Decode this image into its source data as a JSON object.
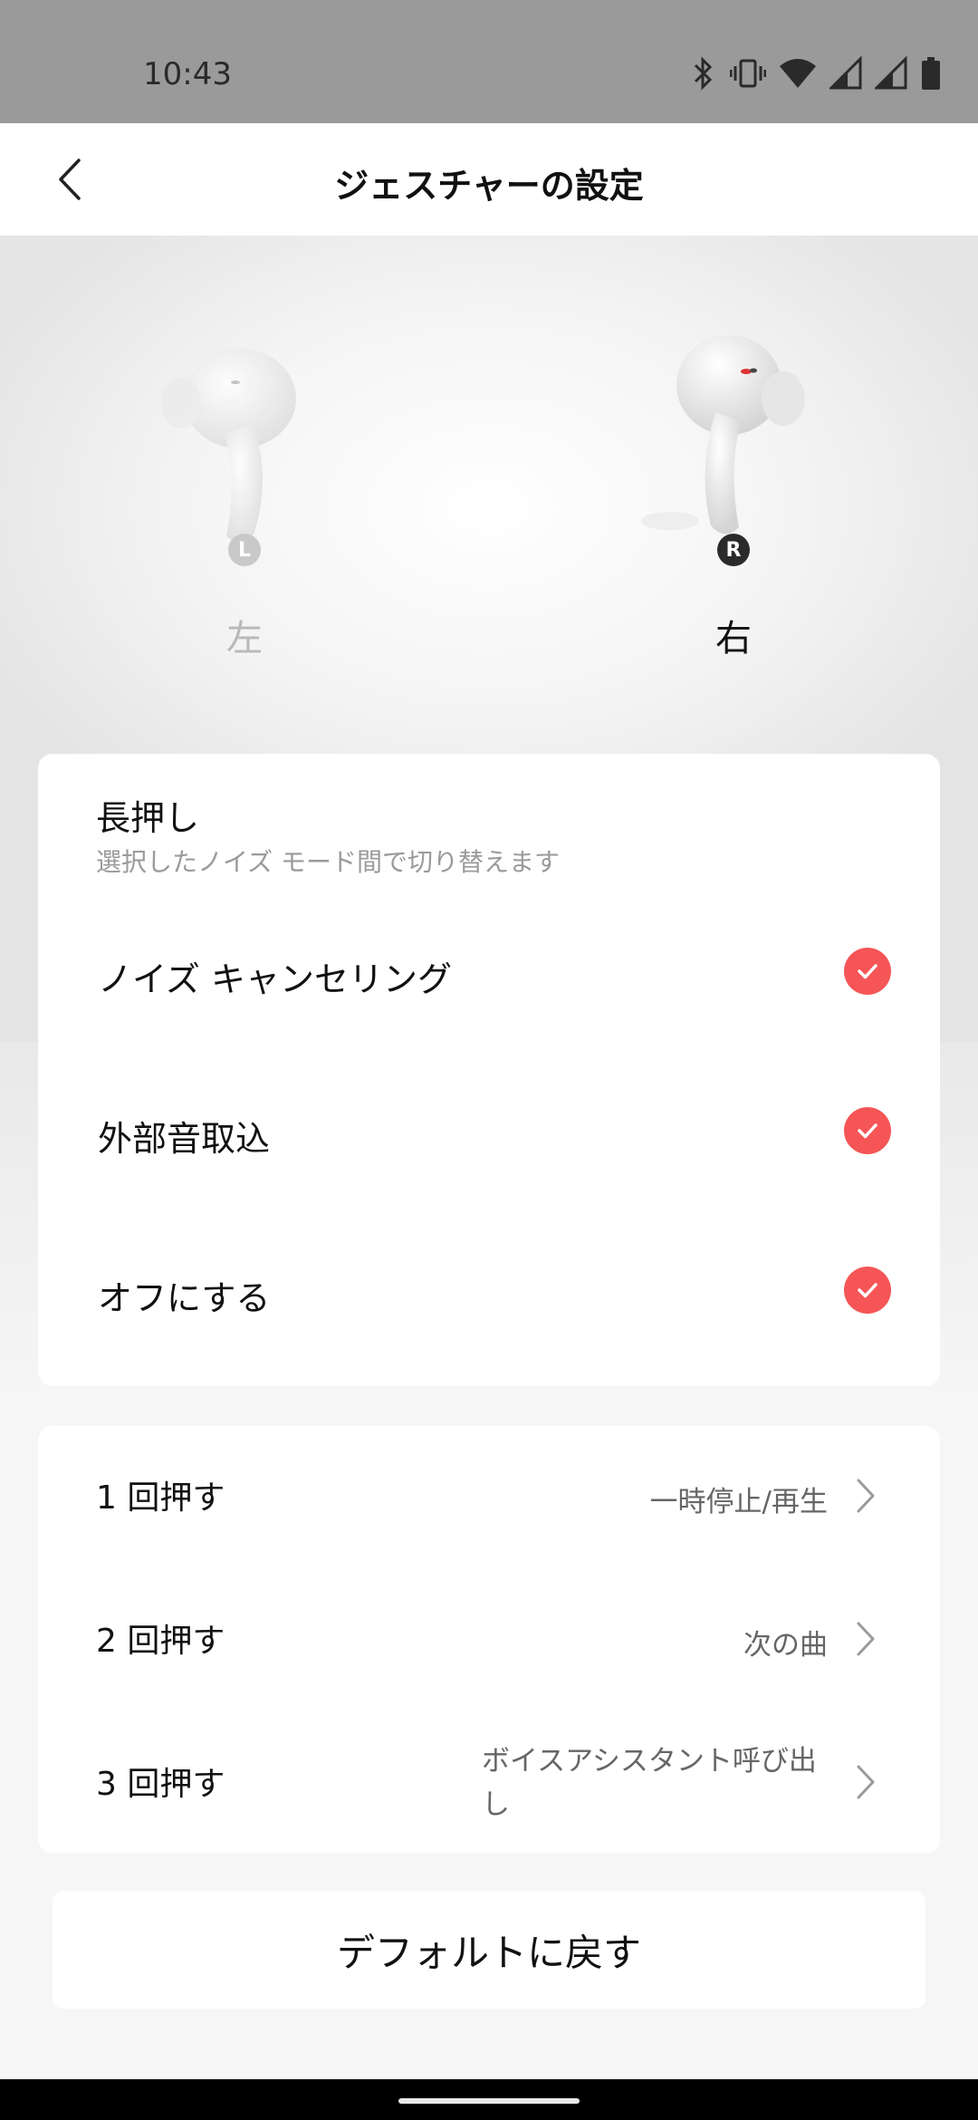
{
  "status_bar": {
    "time": "10:43",
    "icons": [
      "bluetooth-icon",
      "vibrate-icon",
      "wifi-icon",
      "signal-icon",
      "signal-icon",
      "battery-icon"
    ]
  },
  "header": {
    "title": "ジェスチャーの設定",
    "back_icon": "chevron-left-icon"
  },
  "earbuds": {
    "left": {
      "badge": "L",
      "label": "左"
    },
    "right": {
      "badge": "R",
      "label": "右"
    },
    "selected": "right"
  },
  "long_press": {
    "title": "長押し",
    "subtitle": "選択したノイズ モード間で切り替えます",
    "options": [
      {
        "label": "ノイズ キャンセリング",
        "checked": true
      },
      {
        "label": "外部音取込",
        "checked": true
      },
      {
        "label": "オフにする",
        "checked": true
      }
    ]
  },
  "press_actions": [
    {
      "label": "1 回押す",
      "value": "一時停止/再生"
    },
    {
      "label": "2 回押す",
      "value": "次の曲"
    },
    {
      "label": "3 回押す",
      "value": "ボイスアシスタント呼び出し"
    }
  ],
  "reset_button": "デフォルトに戻す",
  "colors": {
    "accent": "#f55556",
    "status_bar": "#9a9a9a"
  }
}
